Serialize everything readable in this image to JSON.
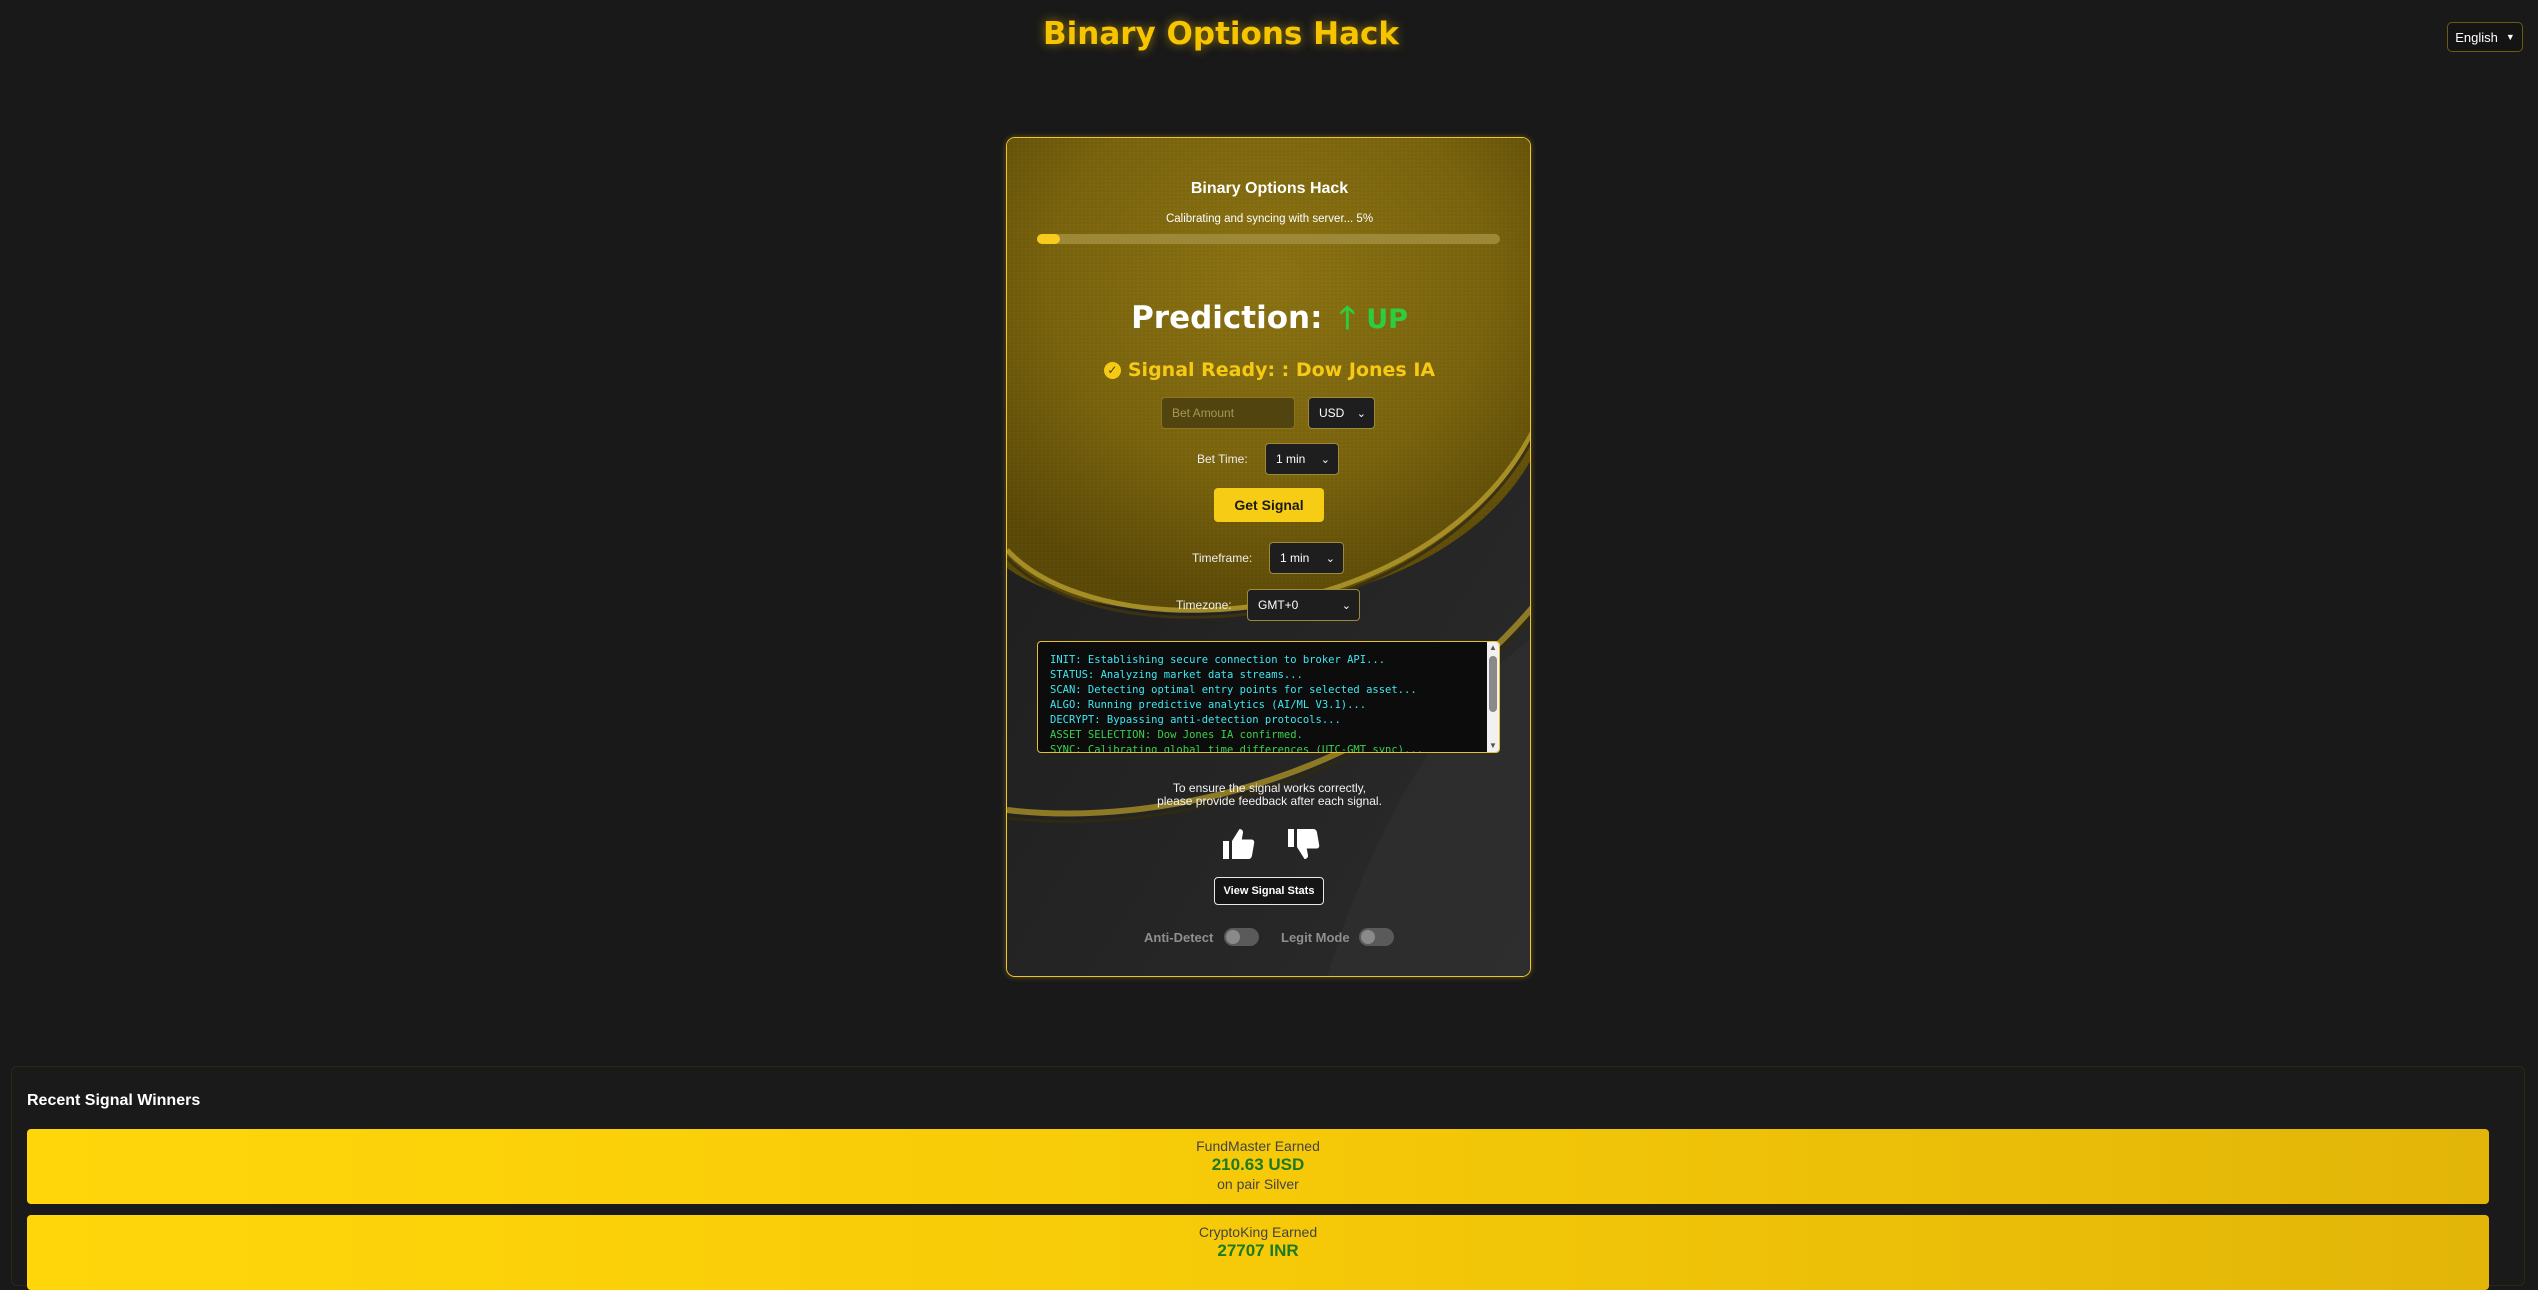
{
  "header": {
    "title": "Binary Options Hack",
    "language": "English"
  },
  "card": {
    "title": "Binary Options Hack",
    "progress_label": "Calibrating and syncing with server... 5%",
    "progress_percent": 5,
    "prediction_label": "Prediction:",
    "prediction_arrow": "🡑",
    "prediction_direction": "UP",
    "signal_check": "✓",
    "signal_text": "Signal Ready: : Dow Jones IA",
    "bet_amount_placeholder": "Bet Amount",
    "currency": "USD",
    "bet_time_label": "Bet Time:",
    "bet_time": "1 min",
    "get_signal_label": "Get Signal",
    "timeframe_label": "Timeframe:",
    "timeframe": "1 min",
    "timezone_label": "Timezone:",
    "timezone": "GMT+0",
    "console": [
      {
        "text": "INIT: Establishing secure connection to broker API...",
        "color": "#3ee7f2"
      },
      {
        "text": "STATUS: Analyzing market data streams...",
        "color": "#3ee7f2"
      },
      {
        "text": "SCAN: Detecting optimal entry points for selected asset...",
        "color": "#3ee7f2"
      },
      {
        "text": "ALGO: Running predictive analytics (AI/ML V3.1)...",
        "color": "#3ee7f2"
      },
      {
        "text": "DECRYPT: Bypassing anti-detection protocols...",
        "color": "#3ee7f2"
      },
      {
        "text": "ASSET SELECTION: Dow Jones IA confirmed.",
        "color": "#3ccf4e"
      },
      {
        "text": "SYNC: Calibrating global time differences (UTC-GMT sync)...",
        "color": "#3ccf4e"
      }
    ],
    "feedback_line1": "To ensure the signal works correctly,",
    "feedback_line2": "please provide feedback after each signal.",
    "view_stats_label": "View Signal Stats",
    "anti_detect_label": "Anti-Detect",
    "legit_mode_label": "Legit Mode"
  },
  "winners": {
    "title": "Recent Signal Winners",
    "items": [
      {
        "name": "FundMaster Earned",
        "amount": "210.63 USD",
        "pair": "on pair Silver"
      },
      {
        "name": "CryptoKing Earned",
        "amount": "27707 INR",
        "pair": ""
      }
    ]
  },
  "colors": {
    "accent": "#f7c400",
    "up": "#2ecc40"
  }
}
